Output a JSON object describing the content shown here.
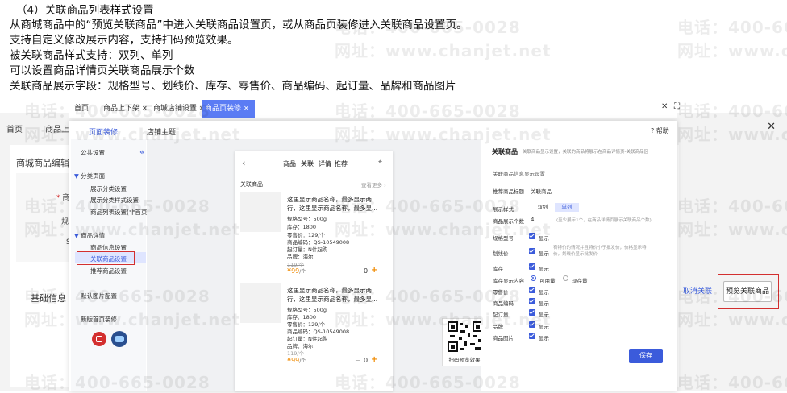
{
  "doc": {
    "heading": "（4）关联商品列表样式设置",
    "lines": [
      "从商城商品中的“预览关联商品”中进入关联商品设置页，或从商品页装修进入关联商品设置页。",
      "支持自定义修改展示内容，支持扫码预览效果。",
      "被关联商品样式支持：双列、单列",
      "可以设置商品详情页关联商品展示个数",
      "关联商品展示字段：规格型号、划线价、库存、零售价、商品编码、起订量、品牌和商品图片"
    ]
  },
  "watermark": {
    "phone": "电话：400-665-0028",
    "site": "网址：www.chanjet.net"
  },
  "background": {
    "nav": [
      "首页",
      "商品上下"
    ],
    "card_title": "商城商品编辑",
    "form_labels": [
      "* 商品",
      "规格",
      "S"
    ],
    "basic_info": "基础信息",
    "cancel_label": "取消关联",
    "preview_label": "预览关联商品"
  },
  "tabs": [
    {
      "label": "首页",
      "closable": false,
      "active": false
    },
    {
      "label": "商品上下架",
      "closable": true,
      "active": false
    },
    {
      "label": "商城店铺设置",
      "closable": true,
      "active": false
    },
    {
      "label": "商品页装修",
      "closable": true,
      "active": true
    }
  ],
  "panel": {
    "tabs": [
      "页面装修",
      "店铺主题"
    ],
    "help": "帮助",
    "tree": [
      {
        "label": "公共设置",
        "level": 0
      },
      {
        "label": "分类页面",
        "level": 0,
        "expanded": true
      },
      {
        "label": "展示分类设置",
        "level": 1
      },
      {
        "label": "展示分类样式设置",
        "level": 1
      },
      {
        "label": "商品列表设置(非首页)",
        "level": 1
      },
      {
        "label": "商品详情",
        "level": 0,
        "expanded": true
      },
      {
        "label": "商品信息设置",
        "level": 1
      },
      {
        "label": "关联商品设置",
        "level": 1,
        "selected": true
      },
      {
        "label": "推荐商品设置",
        "level": 1
      },
      {
        "label": "默认图片配置",
        "level": 0
      },
      {
        "label": "新版首页装修",
        "level": 0
      }
    ]
  },
  "phone": {
    "nav": [
      "商品",
      "关联",
      "详情",
      "推荐"
    ],
    "section_title": "关联商品",
    "more": "查看更多 ›",
    "products": [
      {
        "name1": "这里显示商品名称，最多显示两",
        "name2": "行，这里显示商品名称，最多显...",
        "spec": "规格型号：500g",
        "stock": "库存：1800",
        "retail": "零售价：129/个",
        "code": "商品编码：QS-10549008",
        "moq": "起订量：N件起购",
        "brand": "品牌：海尔",
        "strike": "119/个",
        "price": "¥99",
        "unit": "/个",
        "qty": "0"
      },
      {
        "name1": "这里显示商品名称，最多显示两",
        "name2": "行，这里显示商品名称，最多显...",
        "spec": "规格型号：500g",
        "stock": "库存：1800",
        "retail": "零售价：129/个",
        "code": "商品编码：QS-10549008",
        "moq": "起订量：N件起购",
        "brand": "品牌：海尔",
        "strike": "119/个",
        "price": "¥99",
        "unit": "/个",
        "qty": "0"
      }
    ],
    "qr_label": "扫码预览效果"
  },
  "settings": {
    "title": "关联商品",
    "desc": "关联商品显示设置，关联的商品将展示在商品详情页-关联商品区",
    "section": "关联商品信息显示设置",
    "recommend_label": "推荐商品标题",
    "recommend_value": "关联商品",
    "style_label": "展示样式",
    "style_options": [
      "双列",
      "单列"
    ],
    "style_selected": "单列",
    "count_label": "商品展示个数",
    "count_value": "4",
    "count_hint": "(至少展示1个，在商品详情页展示关联商品个数)",
    "fields": [
      {
        "label": "规格型号",
        "text": "显示"
      },
      {
        "label": "划线价",
        "text": "显示"
      },
      {
        "label": "库存",
        "text": "显示"
      },
      {
        "label": "零售价",
        "text": "显示"
      },
      {
        "label": "商品编码",
        "text": "显示"
      },
      {
        "label": "起订量",
        "text": "显示"
      },
      {
        "label": "品牌",
        "text": "显示"
      },
      {
        "label": "商品图片",
        "text": "显示"
      }
    ],
    "strike_hint1": "有特价的情况并且特价小于批发价，价格显示特",
    "strike_hint2": "价，划线价显示批发价",
    "stock_label": "库存显示内容",
    "stock_options": [
      "可用量",
      "现存量"
    ],
    "stock_selected": "可用量",
    "save": "保存"
  },
  "colors": {
    "primary": "#3b5bdb",
    "highlight": "#d32f2f",
    "price": "#f08a00"
  }
}
